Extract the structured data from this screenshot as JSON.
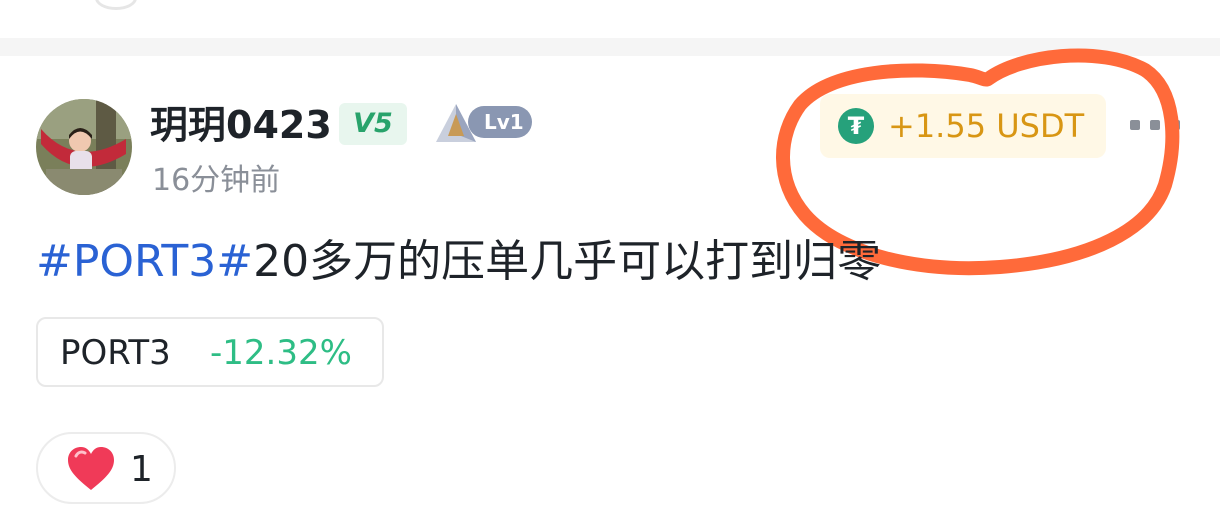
{
  "post": {
    "author": {
      "name": "玥玥0423",
      "vip_badge": "V5",
      "level_badge": "Lv1",
      "avatar": "avatar-photo"
    },
    "timestamp": "16分钟前",
    "tip": {
      "icon": "tether-icon",
      "text": "+1.55 USDT",
      "currency_color": "#26a17b",
      "text_color": "#d89614"
    },
    "more_icon": "more-dots-icon",
    "content": {
      "hashtag": "#PORT3#",
      "text": "20多万的压单几乎可以打到归零"
    },
    "coin_tag": {
      "symbol": "PORT3",
      "change": "-12.32%",
      "change_color": "#2ebd85"
    },
    "reactions": {
      "icon": "heart-icon",
      "count": "1"
    }
  },
  "colors": {
    "hashtag": "#2a62d4",
    "annotation_circle": "#ff6a3a"
  }
}
